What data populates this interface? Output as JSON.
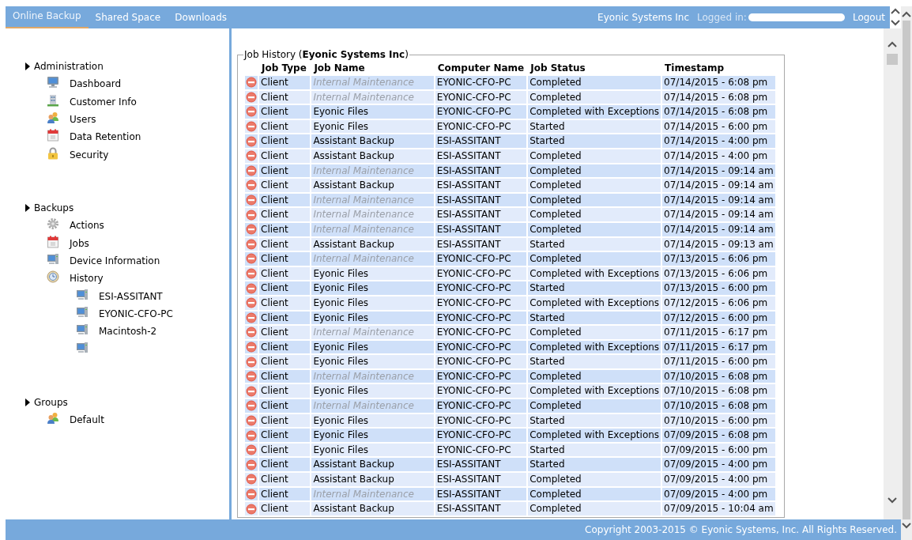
{
  "top_bar": {
    "tabs": [
      {
        "label": "Online Backup",
        "selected": true
      },
      {
        "label": "Shared Space",
        "selected": false
      },
      {
        "label": "Downloads",
        "selected": false
      }
    ],
    "company": "Eyonic Systems Inc",
    "logged_in_label": "Logged in:",
    "logout": "Logout"
  },
  "sidebar": {
    "sections": [
      {
        "title": "Administration",
        "items": [
          {
            "label": "Dashboard",
            "kind": "monitor"
          },
          {
            "label": "Customer Info",
            "kind": "building"
          },
          {
            "label": "Users",
            "kind": "users"
          },
          {
            "label": "Data Retention",
            "kind": "calendar"
          },
          {
            "label": "Security",
            "kind": "lock"
          }
        ]
      },
      {
        "title": "Backups",
        "items": [
          {
            "label": "Actions",
            "kind": "gear"
          },
          {
            "label": "Jobs",
            "kind": "calendar"
          },
          {
            "label": "Device Information",
            "kind": "computer"
          },
          {
            "label": "History",
            "kind": "clock",
            "children": [
              {
                "label": "ESI-ASSITANT",
                "kind": "computer"
              },
              {
                "label": "EYONIC-CFO-PC",
                "kind": "computer"
              },
              {
                "label": "Macintosh-2",
                "kind": "computer"
              },
              {
                "kind": "computer"
              }
            ]
          }
        ]
      },
      {
        "title": "Groups",
        "items": [
          {
            "label": "Default",
            "kind": "users"
          }
        ]
      }
    ]
  },
  "job_history": {
    "title": "Job History (**Eyonic Systems Inc**)",
    "columns": [
      "Job Type",
      "Job Name",
      "Computer Name",
      "Job Status",
      "Timestamp"
    ],
    "rows": [
      {
        "job_type": "Client",
        "job_name": "Internal Maintenance",
        "greyed": true,
        "computer_name": "EYONIC-CFO-PC",
        "job_status": "Completed",
        "timestamp": "07/14/2015 - 6:08 pm"
      },
      {
        "job_type": "Client",
        "job_name": "Internal Maintenance",
        "greyed": true,
        "computer_name": "EYONIC-CFO-PC",
        "job_status": "Completed",
        "timestamp": "07/14/2015 - 6:08 pm"
      },
      {
        "job_type": "Client",
        "job_name": "Eyonic Files",
        "greyed": false,
        "computer_name": "EYONIC-CFO-PC",
        "job_status": "Completed with Exceptions",
        "timestamp": "07/14/2015 - 6:08 pm"
      },
      {
        "job_type": "Client",
        "job_name": "Eyonic Files",
        "greyed": false,
        "computer_name": "EYONIC-CFO-PC",
        "job_status": "Started",
        "timestamp": "07/14/2015 - 6:00 pm"
      },
      {
        "job_type": "Client",
        "job_name": "Assistant Backup",
        "greyed": false,
        "computer_name": "ESI-ASSITANT",
        "job_status": "Started",
        "timestamp": "07/14/2015 - 4:00 pm"
      },
      {
        "job_type": "Client",
        "job_name": "Assistant Backup",
        "greyed": false,
        "computer_name": "ESI-ASSITANT",
        "job_status": "Completed",
        "timestamp": "07/14/2015 - 4:00 pm"
      },
      {
        "job_type": "Client",
        "job_name": "Internal Maintenance",
        "greyed": true,
        "computer_name": "ESI-ASSITANT",
        "job_status": "Completed",
        "timestamp": "07/14/2015 - 09:14 am"
      },
      {
        "job_type": "Client",
        "job_name": "Assistant Backup",
        "greyed": false,
        "computer_name": "ESI-ASSITANT",
        "job_status": "Completed",
        "timestamp": "07/14/2015 - 09:14 am"
      },
      {
        "job_type": "Client",
        "job_name": "Internal Maintenance",
        "greyed": true,
        "computer_name": "ESI-ASSITANT",
        "job_status": "Completed",
        "timestamp": "07/14/2015 - 09:14 am"
      },
      {
        "job_type": "Client",
        "job_name": "Internal Maintenance",
        "greyed": true,
        "computer_name": "ESI-ASSITANT",
        "job_status": "Completed",
        "timestamp": "07/14/2015 - 09:14 am"
      },
      {
        "job_type": "Client",
        "job_name": "Internal Maintenance",
        "greyed": true,
        "computer_name": "ESI-ASSITANT",
        "job_status": "Completed",
        "timestamp": "07/14/2015 - 09:14 am"
      },
      {
        "job_type": "Client",
        "job_name": "Assistant Backup",
        "greyed": false,
        "computer_name": "ESI-ASSITANT",
        "job_status": "Started",
        "timestamp": "07/14/2015 - 09:13 am"
      },
      {
        "job_type": "Client",
        "job_name": "Internal Maintenance",
        "greyed": true,
        "computer_name": "EYONIC-CFO-PC",
        "job_status": "Completed",
        "timestamp": "07/13/2015 - 6:06 pm"
      },
      {
        "job_type": "Client",
        "job_name": "Eyonic Files",
        "greyed": false,
        "computer_name": "EYONIC-CFO-PC",
        "job_status": "Completed with Exceptions",
        "timestamp": "07/13/2015 - 6:06 pm"
      },
      {
        "job_type": "Client",
        "job_name": "Eyonic Files",
        "greyed": false,
        "computer_name": "EYONIC-CFO-PC",
        "job_status": "Started",
        "timestamp": "07/13/2015 - 6:00 pm"
      },
      {
        "job_type": "Client",
        "job_name": "Eyonic Files",
        "greyed": false,
        "computer_name": "EYONIC-CFO-PC",
        "job_status": "Completed with Exceptions",
        "timestamp": "07/12/2015 - 6:06 pm"
      },
      {
        "job_type": "Client",
        "job_name": "Eyonic Files",
        "greyed": false,
        "computer_name": "EYONIC-CFO-PC",
        "job_status": "Started",
        "timestamp": "07/12/2015 - 6:00 pm"
      },
      {
        "job_type": "Client",
        "job_name": "Internal Maintenance",
        "greyed": true,
        "computer_name": "EYONIC-CFO-PC",
        "job_status": "Completed",
        "timestamp": "07/11/2015 - 6:17 pm"
      },
      {
        "job_type": "Client",
        "job_name": "Eyonic Files",
        "greyed": false,
        "computer_name": "EYONIC-CFO-PC",
        "job_status": "Completed with Exceptions",
        "timestamp": "07/11/2015 - 6:17 pm"
      },
      {
        "job_type": "Client",
        "job_name": "Eyonic Files",
        "greyed": false,
        "computer_name": "EYONIC-CFO-PC",
        "job_status": "Started",
        "timestamp": "07/11/2015 - 6:00 pm"
      },
      {
        "job_type": "Client",
        "job_name": "Internal Maintenance",
        "greyed": true,
        "computer_name": "EYONIC-CFO-PC",
        "job_status": "Completed",
        "timestamp": "07/10/2015 - 6:08 pm"
      },
      {
        "job_type": "Client",
        "job_name": "Eyonic Files",
        "greyed": false,
        "computer_name": "EYONIC-CFO-PC",
        "job_status": "Completed with Exceptions",
        "timestamp": "07/10/2015 - 6:08 pm"
      },
      {
        "job_type": "Client",
        "job_name": "Internal Maintenance",
        "greyed": true,
        "computer_name": "EYONIC-CFO-PC",
        "job_status": "Completed",
        "timestamp": "07/10/2015 - 6:08 pm"
      },
      {
        "job_type": "Client",
        "job_name": "Eyonic Files",
        "greyed": false,
        "computer_name": "EYONIC-CFO-PC",
        "job_status": "Started",
        "timestamp": "07/10/2015 - 6:00 pm"
      },
      {
        "job_type": "Client",
        "job_name": "Eyonic Files",
        "greyed": false,
        "computer_name": "EYONIC-CFO-PC",
        "job_status": "Completed with Exceptions",
        "timestamp": "07/09/2015 - 6:08 pm"
      },
      {
        "job_type": "Client",
        "job_name": "Eyonic Files",
        "greyed": false,
        "computer_name": "EYONIC-CFO-PC",
        "job_status": "Started",
        "timestamp": "07/09/2015 - 6:00 pm"
      },
      {
        "job_type": "Client",
        "job_name": "Assistant Backup",
        "greyed": false,
        "computer_name": "ESI-ASSITANT",
        "job_status": "Started",
        "timestamp": "07/09/2015 - 4:00 pm"
      },
      {
        "job_type": "Client",
        "job_name": "Assistant Backup",
        "greyed": false,
        "computer_name": "ESI-ASSITANT",
        "job_status": "Completed",
        "timestamp": "07/09/2015 - 4:00 pm"
      },
      {
        "job_type": "Client",
        "job_name": "Internal Maintenance",
        "greyed": true,
        "computer_name": "ESI-ASSITANT",
        "job_status": "Completed",
        "timestamp": "07/09/2015 - 4:00 pm"
      },
      {
        "job_type": "Client",
        "job_name": "Assistant Backup",
        "greyed": false,
        "computer_name": "ESI-ASSITANT",
        "job_status": "Completed",
        "timestamp": "07/09/2015 - 10:04 am"
      }
    ]
  },
  "footer": {
    "copyright": "Copyright 2003-2015 © Eyonic Systems, Inc. All Rights Reserved."
  }
}
